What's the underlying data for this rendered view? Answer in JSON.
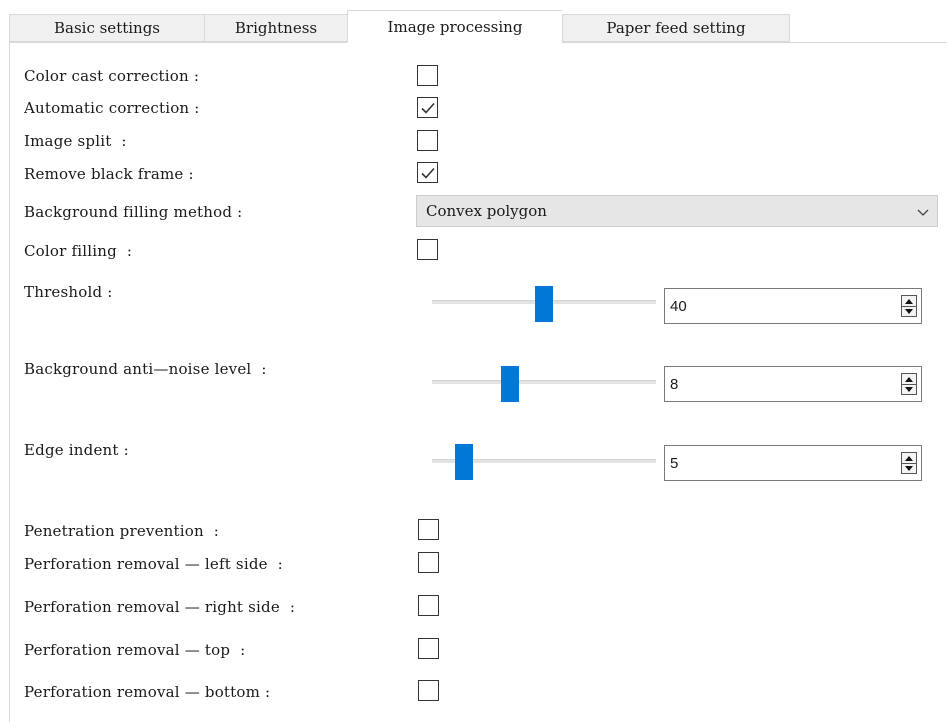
{
  "tabs": [
    {
      "label": "Basic settings",
      "active": false
    },
    {
      "label": "Brightness",
      "active": false
    },
    {
      "label": "Image processing",
      "active": true
    },
    {
      "label": "Paper feed setting",
      "active": false
    }
  ],
  "image_processing": {
    "color_cast_correction": {
      "label": "Color cast correction :",
      "checked": false
    },
    "automatic_correction": {
      "label": "Automatic correction :",
      "checked": true
    },
    "image_split": {
      "label": "Image split  :",
      "checked": false
    },
    "remove_black_frame": {
      "label": "Remove black frame :",
      "checked": true
    },
    "background_filling_method": {
      "label": "Background filling method :",
      "value": "Convex polygon"
    },
    "color_filling": {
      "label": "Color filling  :",
      "checked": false
    },
    "threshold": {
      "label": "Threshold :",
      "value": "40"
    },
    "background_anti_noise_level": {
      "label": "Background anti—noise level  :",
      "value": "8"
    },
    "edge_indent": {
      "label": "Edge indent :",
      "value": "5"
    },
    "penetration_prevention": {
      "label": "Penetration prevention  :",
      "checked": false
    },
    "perforation_removal_left": {
      "label": "Perforation removal — left side  :",
      "checked": false
    },
    "perforation_removal_right": {
      "label": "Perforation removal — right side  :",
      "checked": false
    },
    "perforation_removal_top": {
      "label": "Perforation removal — top  :",
      "checked": false
    },
    "perforation_removal_bottom": {
      "label": "Perforation removal — bottom :",
      "checked": false
    }
  },
  "colors": {
    "accent": "#0078d7",
    "tab_inactive": "#f0f0f0",
    "combo_background": "#e6e6e6"
  },
  "icons": {
    "checkmark": "checkmark-icon",
    "combo": "chevron-down-icon",
    "spin_up": "spin-up-arrow-icon",
    "spin_down": "spin-down-arrow-icon"
  }
}
